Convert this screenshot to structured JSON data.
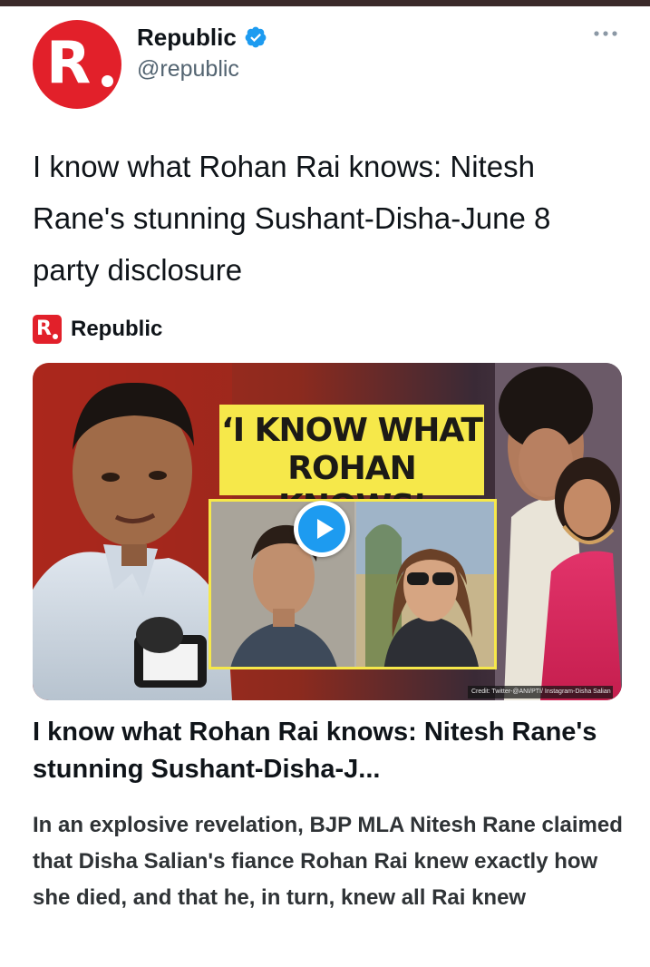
{
  "author": {
    "display_name": "Republic",
    "handle": "@republic",
    "verified": true,
    "avatar_letter": "R",
    "brand_color": "#e2202a",
    "verified_color": "#1d9bf0"
  },
  "more_icon": "more-horizontal-icon",
  "tweet": {
    "text": "I know what Rohan Rai knows: Nitesh Rane's stunning Sushant-Disha-June 8 party disclosure"
  },
  "link_card": {
    "source_logo_letter": "R.",
    "source_name": "Republic",
    "media": {
      "headline_line1": "‘I KNOW WHAT",
      "headline_line2": "ROHAN KNOWS’",
      "credit": "Credit: Twitter-@ANI/PTI/ Instagram-Disha Salian",
      "play_icon": "play-icon",
      "headline_bg_color": "#f6e84a"
    },
    "title": "I know what Rohan Rai knows: Nitesh Rane's stunning Sushant-Disha-J...",
    "description": "In an explosive revelation, BJP MLA Nitesh Rane claimed that Disha Salian's fiance Rohan Rai knew exactly how she died, and that he, in turn, knew all Rai knew"
  }
}
